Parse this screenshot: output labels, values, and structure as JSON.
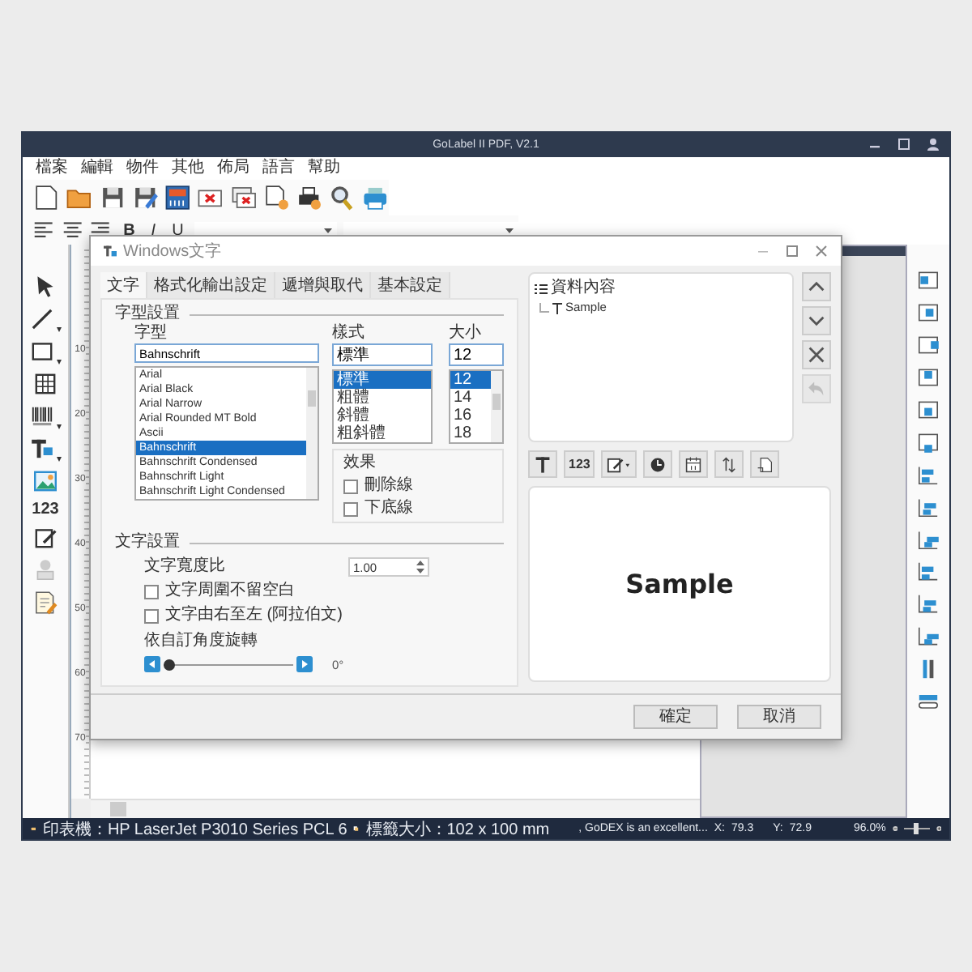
{
  "window": {
    "title": "GoLabel II PDF, V2.1"
  },
  "menu": [
    "檔案",
    "編輯",
    "物件",
    "其他",
    "佈局",
    "語言",
    "幫助"
  ],
  "format_buttons": [
    "B",
    "I",
    "U"
  ],
  "tools": {
    "number_tool": "123"
  },
  "ruler": {
    "marks": [
      "10",
      "20",
      "30",
      "40",
      "50",
      "60",
      "70"
    ]
  },
  "dialog": {
    "title": "Windows文字",
    "tabs": [
      {
        "label": "文字",
        "selected": true
      },
      {
        "label": "格式化輸出設定",
        "selected": false
      },
      {
        "label": "遞增與取代",
        "selected": false
      },
      {
        "label": "基本設定",
        "selected": false
      }
    ],
    "font_group": {
      "title": "字型設置",
      "font_label": "字型",
      "font_value": "Bahnschrift",
      "fonts": [
        {
          "name": "Arial",
          "selected": false
        },
        {
          "name": "Arial Black",
          "selected": false
        },
        {
          "name": "Arial Narrow",
          "selected": false
        },
        {
          "name": "Arial Rounded MT Bold",
          "selected": false
        },
        {
          "name": "Ascii",
          "selected": false
        },
        {
          "name": "Bahnschrift",
          "selected": true
        },
        {
          "name": "Bahnschrift Condensed",
          "selected": false
        },
        {
          "name": "Bahnschrift Light",
          "selected": false
        },
        {
          "name": "Bahnschrift Light Condensed",
          "selected": false
        }
      ],
      "style_label": "樣式",
      "style_value": "標準",
      "styles": [
        {
          "name": "標準",
          "selected": true
        },
        {
          "name": "粗體",
          "selected": false
        },
        {
          "name": "斜體",
          "selected": false
        },
        {
          "name": "粗斜體",
          "selected": false
        }
      ],
      "size_label": "大小",
      "size_value": "12",
      "sizes": [
        {
          "name": "12",
          "selected": true
        },
        {
          "name": "14",
          "selected": false
        },
        {
          "name": "16",
          "selected": false
        },
        {
          "name": "18",
          "selected": false
        }
      ]
    },
    "effects": {
      "title": "效果",
      "items": [
        {
          "label": "刪除線",
          "checked": false
        },
        {
          "label": "下底線",
          "checked": false
        }
      ]
    },
    "text_group": {
      "title": "文字設置",
      "ratio_label": "文字寬度比",
      "ratio_value": "1.00",
      "options": [
        {
          "label": "文字周圍不留空白",
          "checked": false
        },
        {
          "label": "文字由右至左 (阿拉伯文)",
          "checked": false
        }
      ],
      "rotate_label": "依自訂角度旋轉",
      "rotate": {
        "level": 0
      },
      "angle": "0°"
    },
    "tree": {
      "root": "資料內容",
      "children": [
        {
          "label": "Sample"
        }
      ]
    },
    "insert_tools": {
      "number": "123"
    },
    "preview": "Sample",
    "buttons": [
      "確定",
      "取消"
    ]
  },
  "status_bar": {
    "printer": "印表機：HP LaserJet P3010 Series PCL 6",
    "label_size": "標籤大小：102 x 100 mm",
    "message": ", GoDEX is an excellent...",
    "x_label": "X:",
    "x_value": "79.3",
    "y_label": "Y:",
    "y_value": "72.9",
    "zoom": "96.0%",
    "zoom_slider": {
      "level": 0.5
    }
  }
}
